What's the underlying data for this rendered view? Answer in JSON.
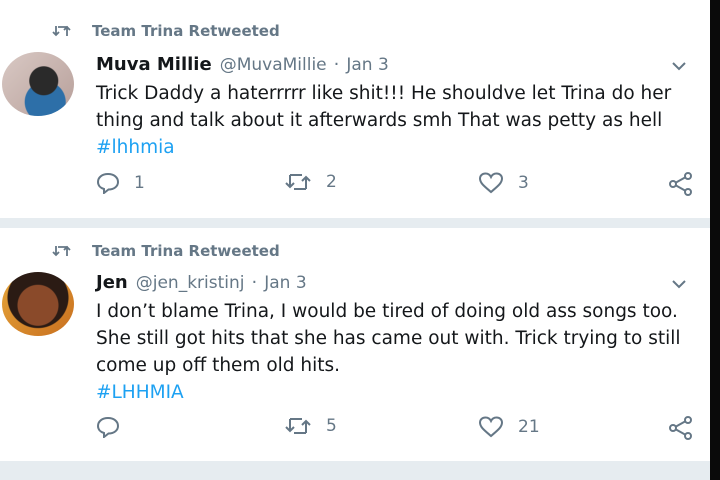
{
  "tweets": [
    {
      "retweet_label": "Team Trina Retweeted",
      "name": "Muva Millie",
      "handle": "@MuvaMillie",
      "separator": "·",
      "date": "Jan 3",
      "text": "Trick Daddy a haterrrrr like shit!!! He shouldve let Trina do her thing and talk about it afterwards smh That was petty as hell ",
      "hashtag": "#lhhmia",
      "replies": "1",
      "retweets": "2",
      "likes": "3"
    },
    {
      "retweet_label": "Team Trina Retweeted",
      "name": "Jen",
      "handle": "@jen_kristinj",
      "separator": "·",
      "date": "Jan 3",
      "text": "I don’t blame Trina, I would be tired of doing old ass songs too. She still got hits that she has came out with. Trick trying to still come up off them old hits.",
      "hashtag": "#LHHMIA",
      "replies": "",
      "retweets": "5",
      "likes": "21"
    }
  ],
  "colors": {
    "accent": "#1da1f2",
    "muted": "#657786",
    "text": "#14171a",
    "divider": "#e6ecf0"
  },
  "icons": [
    "retweet-icon",
    "chevron-down-icon",
    "reply-icon",
    "like-icon",
    "share-icon"
  ]
}
